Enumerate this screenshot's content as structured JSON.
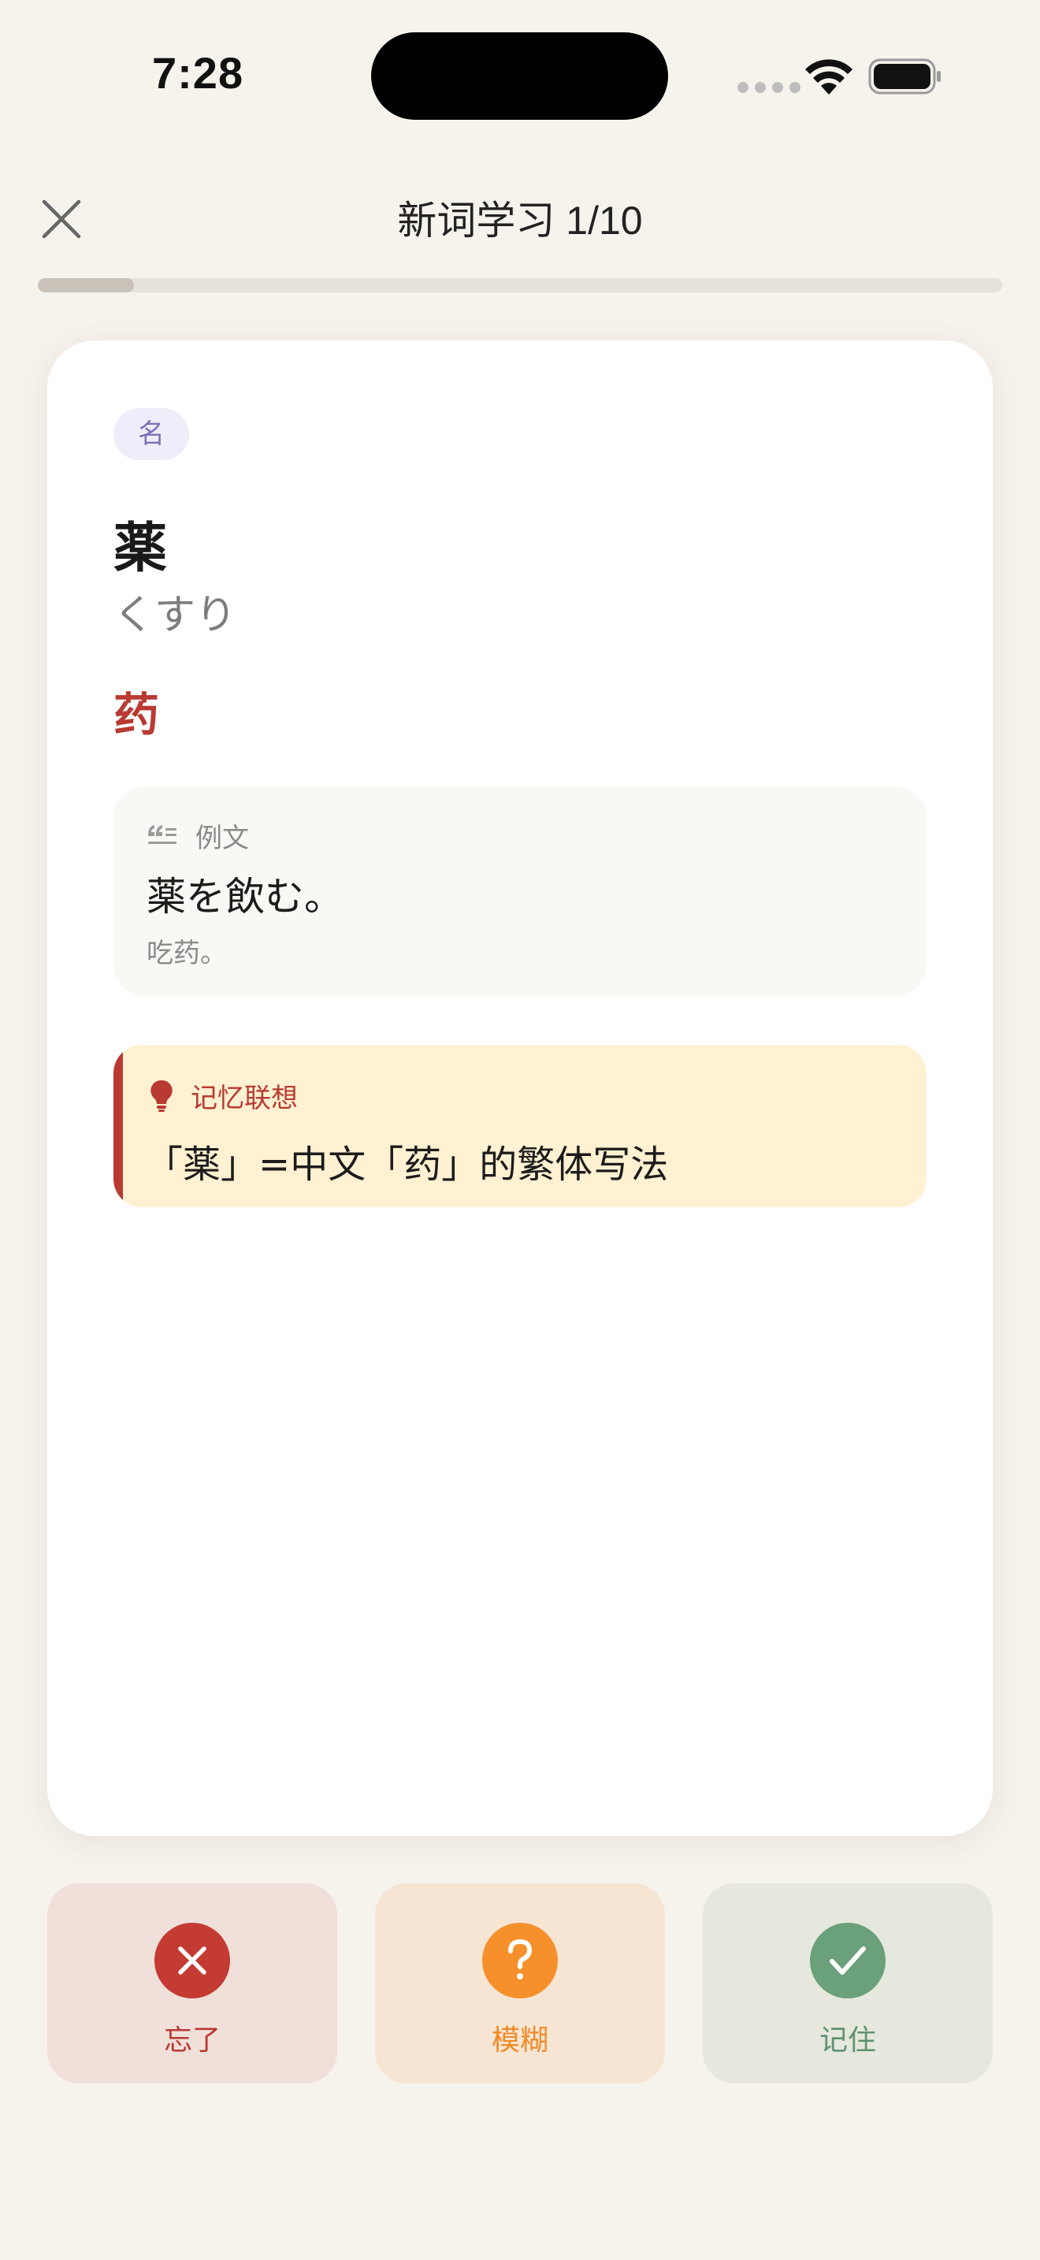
{
  "status_bar": {
    "time": "7:28"
  },
  "header": {
    "title": "新词学习 1/10",
    "progress_fraction": 0.1
  },
  "card": {
    "part_of_speech": "名",
    "word": "薬",
    "reading": "くすり",
    "meaning": "药",
    "example": {
      "label": "例文",
      "japanese": "薬を飲む。",
      "chinese": "吃药。"
    },
    "memory": {
      "label": "记忆联想",
      "text": "「薬」=中文「药」的繁体写法"
    }
  },
  "actions": {
    "forgot_label": "忘了",
    "fuzzy_label": "模糊",
    "remember_label": "记住"
  },
  "colors": {
    "background": "#f6f2ec",
    "accent_red": "#b83a32",
    "accent_orange": "#f6902b",
    "accent_green": "#6aa07a",
    "badge_purple": "#7b72b8"
  },
  "icons": {
    "close": "close-icon",
    "quote": "quote-icon",
    "lightbulb": "lightbulb-icon",
    "forgot": "x-icon",
    "fuzzy": "question-icon",
    "remember": "check-icon"
  }
}
